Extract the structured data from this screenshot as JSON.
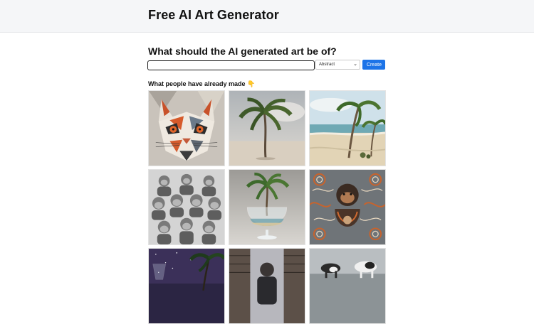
{
  "header": {
    "title": "Free AI Art Generator"
  },
  "prompt": {
    "heading": "What should the AI generated art be of?",
    "input_value": "",
    "style_selected": "Abstract",
    "create_label": "Create"
  },
  "gallery": {
    "heading": "What people have already made",
    "heading_emoji": "👇",
    "items": [
      {
        "subject": "geometric-cat"
      },
      {
        "subject": "palm-tree-beach"
      },
      {
        "subject": "palm-trees-beach"
      },
      {
        "subject": "monkeys-grayscale"
      },
      {
        "subject": "palm-tree-in-glass"
      },
      {
        "subject": "ornate-monkey"
      },
      {
        "subject": "night-glass-palm"
      },
      {
        "subject": "library-person"
      },
      {
        "subject": "dogs-beach"
      }
    ]
  },
  "colors": {
    "accent": "#1d74e8",
    "header_bg": "#f5f6f8"
  }
}
